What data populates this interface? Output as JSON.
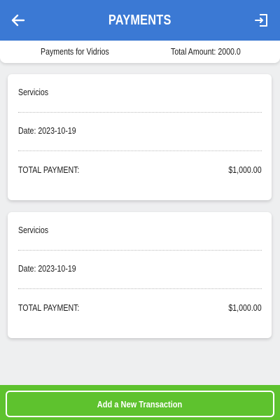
{
  "header": {
    "title": "PAYMENTS",
    "back_icon": "arrow-left-icon",
    "logout_icon": "logout-icon",
    "color": "#3b79d4"
  },
  "summary": {
    "label": "Payments for Vidrios",
    "total": "Total Amount: 2000.0"
  },
  "payments": [
    {
      "category": "Servicios",
      "date": "Date: 2023-10-19",
      "total_label": "TOTAL PAYMENT:",
      "amount": "$1,000.00"
    },
    {
      "category": "Servicios",
      "date": "Date: 2023-10-19",
      "total_label": "TOTAL PAYMENT:",
      "amount": "$1,000.00"
    }
  ],
  "footer": {
    "add_label": "Add a New Transaction",
    "color": "#5ec22e"
  }
}
